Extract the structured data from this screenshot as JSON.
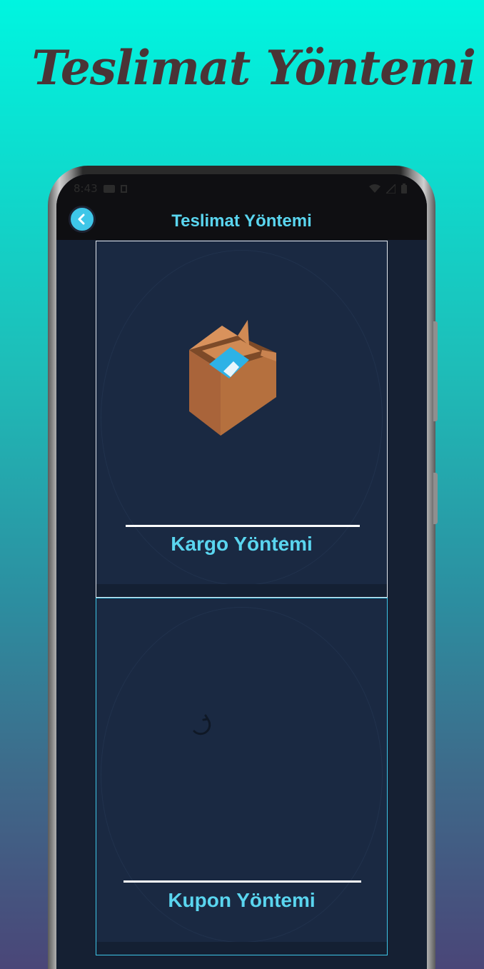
{
  "promo": {
    "title": "Teslimat Yöntemi"
  },
  "status_bar": {
    "time": "8:43"
  },
  "app_bar": {
    "title": "Teslimat Yöntemi"
  },
  "options": [
    {
      "label": "Kargo Yöntemi",
      "icon": "box-icon"
    },
    {
      "label": "Kupon Yöntemi",
      "icon": "loading-spinner-icon"
    }
  ],
  "colors": {
    "accent": "#5ad5ef",
    "card_bg": "#1a2942",
    "screen_bg": "#152033",
    "title_text": "#4a3436"
  }
}
